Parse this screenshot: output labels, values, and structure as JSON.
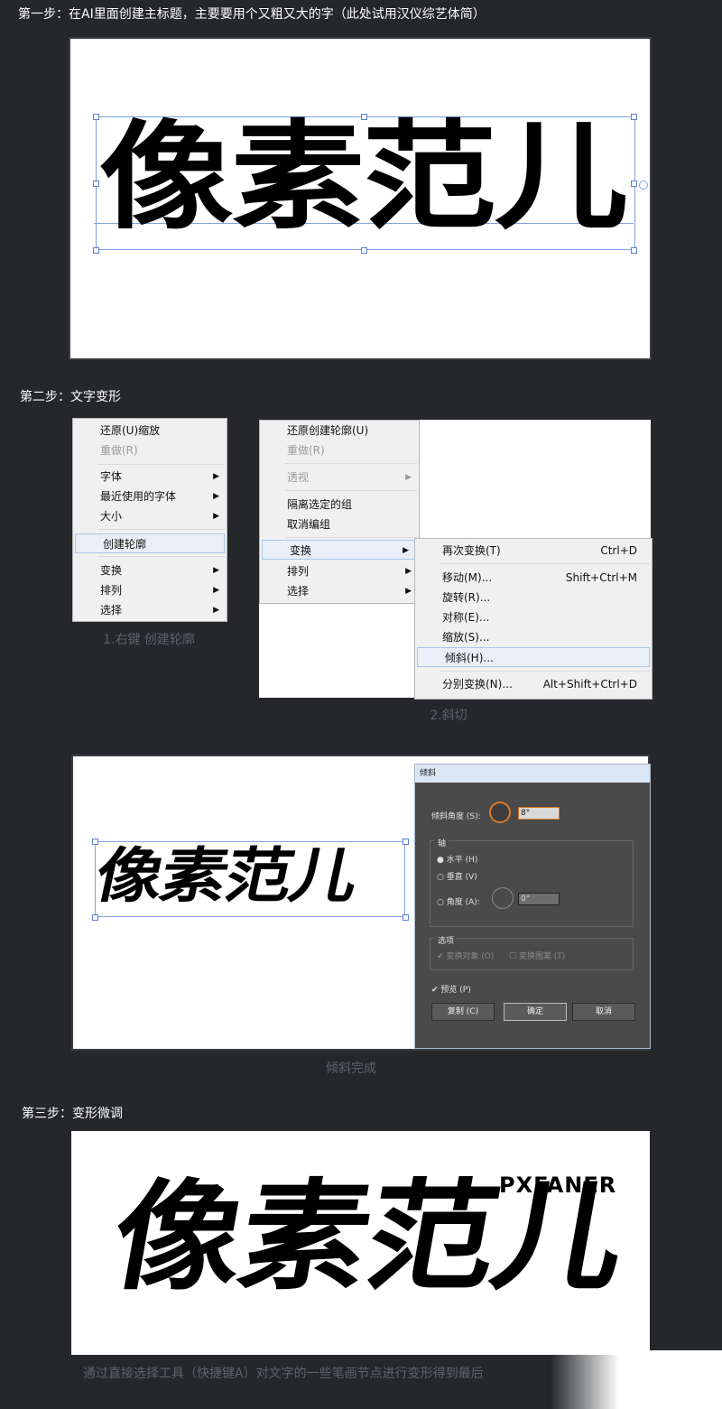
{
  "step1": {
    "heading": "第一步：在AI里面创建主标题，主要要用个又粗又大的字（此处试用汉仪综艺体简）"
  },
  "title_text": "像素范儿",
  "step2": {
    "heading": "第二步：文字变形",
    "menu1": {
      "items": [
        {
          "label": "还原(U)缩放",
          "disabled": false
        },
        {
          "label": "重做(R)",
          "disabled": true
        },
        {
          "label": "字体",
          "submenu": true
        },
        {
          "label": "最近使用的字体",
          "submenu": true
        },
        {
          "label": "大小",
          "submenu": true
        },
        {
          "label": "创建轮廓",
          "highlighted": true
        },
        {
          "label": "变换",
          "submenu": true
        },
        {
          "label": "排列",
          "submenu": true
        },
        {
          "label": "选择",
          "submenu": true
        }
      ],
      "caption": "1.右键 创建轮廓"
    },
    "menu2": {
      "items": [
        {
          "label": "还原创建轮廓(U)"
        },
        {
          "label": "重做(R)",
          "disabled": true
        },
        {
          "label": "透视",
          "disabled": true,
          "submenu": true
        },
        {
          "label": "隔离选定的组"
        },
        {
          "label": "取消编组"
        },
        {
          "label": "变换",
          "submenu": true,
          "highlighted": true
        },
        {
          "label": "排列",
          "submenu": true
        },
        {
          "label": "选择",
          "submenu": true
        }
      ],
      "submenu": [
        {
          "label": "再次变换(T)",
          "shortcut": "Ctrl+D"
        },
        {
          "label": "移动(M)...",
          "shortcut": "Shift+Ctrl+M"
        },
        {
          "label": "旋转(R)..."
        },
        {
          "label": "对称(E)..."
        },
        {
          "label": "缩放(S)..."
        },
        {
          "label": "倾斜(H)...",
          "highlighted": true
        },
        {
          "label": "分别变换(N)...",
          "shortcut": "Alt+Shift+Ctrl+D"
        }
      ],
      "caption": "2.斜切"
    },
    "dialog": {
      "title": "倾斜",
      "shear_angle_label": "倾斜角度 (S):",
      "shear_angle_value": "8°",
      "axis_label": "轴",
      "horizontal": "水平 (H)",
      "vertical": "垂直 (V)",
      "angle_label": "角度 (A):",
      "angle_value": "0°",
      "options_label": "选项",
      "transform_objects": "变换对象 (O)",
      "transform_patterns": "变换图案 (T)",
      "preview": "预览 (P)",
      "copy_button": "复制 (C)",
      "ok_button": "确定",
      "cancel_button": "取消"
    },
    "caption3": "倾斜完成"
  },
  "step3": {
    "heading": "第三步：变形微调",
    "brand": "PXFANER",
    "caption": "通过直接选择工具（快捷键A）对文字的一些笔画节点进行变形得到最后"
  }
}
